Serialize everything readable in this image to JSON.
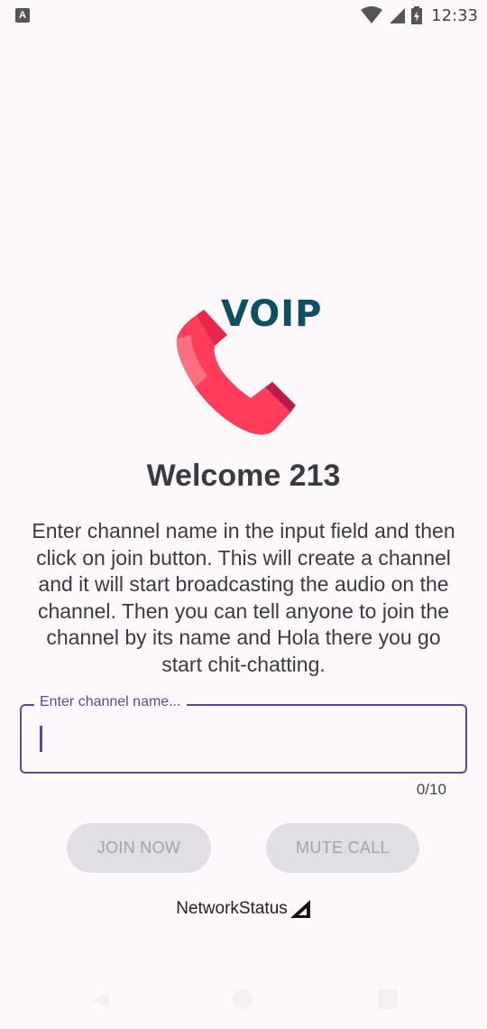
{
  "status_bar": {
    "app_icon_letter": "A",
    "time": "12:33"
  },
  "logo": {
    "text": "VOIP"
  },
  "welcome": "Welcome 213",
  "description": "Enter channel name in the input field and then click on join button. This will create a channel and it will start broadcasting the audio on the channel. Then you can tell anyone to join the channel by its name and Hola there you go start chit-chatting.",
  "channel_input": {
    "label": "Enter channel name...",
    "value": "",
    "counter": "0/10"
  },
  "buttons": {
    "join": "JOIN NOW",
    "mute": "MUTE CALL"
  },
  "network_status": "NetworkStatus",
  "colors": {
    "accent": "#5b4a9a",
    "logo_text": "#0f4f63",
    "phone_pink": "#ff3d5a",
    "button_bg": "#e1dfe3"
  }
}
